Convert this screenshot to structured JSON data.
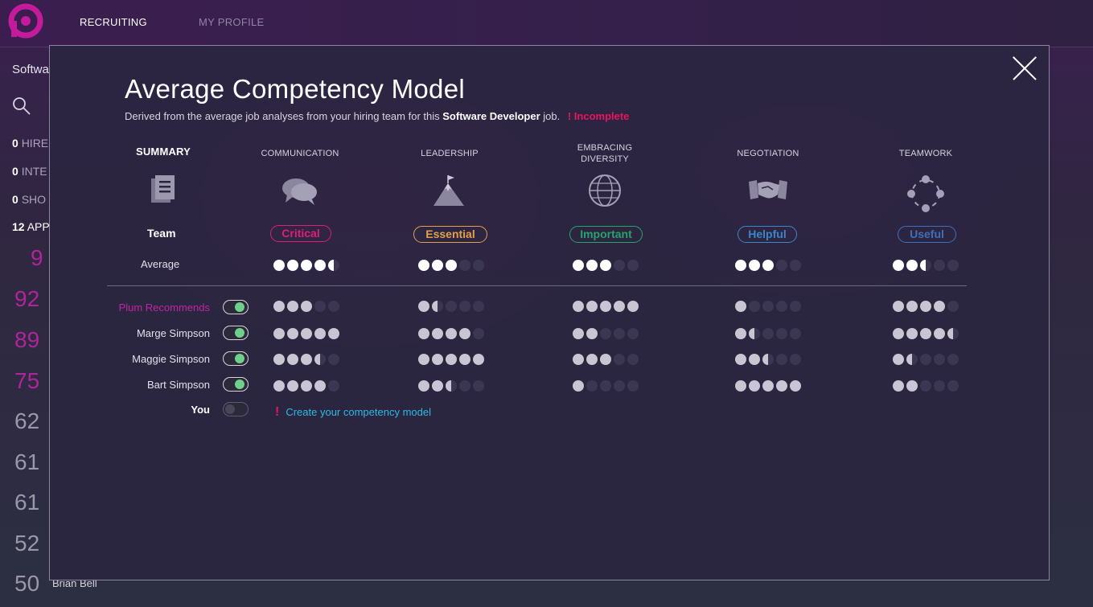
{
  "nav": {
    "items": [
      "RECRUITING",
      "MY PROFILE"
    ]
  },
  "sidebar": {
    "title": "Softwa",
    "stats": [
      {
        "count": "0",
        "label": "HIRE"
      },
      {
        "count": "0",
        "label": "INTE"
      },
      {
        "count": "0",
        "label": "SHO"
      },
      {
        "count": "12",
        "label": "APP"
      }
    ],
    "scores": [
      "9",
      "92",
      "89",
      "75",
      "62",
      "61",
      "61",
      "52",
      "50"
    ],
    "candidate_name": "Brian Bell"
  },
  "modal": {
    "title": "Average Competency Model",
    "subtitle_prefix": "Derived from the average job analyses from your hiring team for this",
    "job": "Software Developer",
    "subtitle_suffix": "job.",
    "warning": "! Incomplete",
    "summary": {
      "heading": "SUMMARY",
      "team": "Team",
      "average": "Average"
    },
    "competencies": [
      {
        "heading": "COMMUNICATION",
        "level": "Critical",
        "color": "#e11d74",
        "average": 4.5
      },
      {
        "heading": "LEADERSHIP",
        "level": "Essential",
        "color": "#e3a04a",
        "average": 3
      },
      {
        "heading": "EMBRACING DIVERSITY",
        "level": "Important",
        "color": "#27a36b",
        "average": 3
      },
      {
        "heading": "NEGOTIATION",
        "level": "Helpful",
        "color": "#3a86c8",
        "average": 3
      },
      {
        "heading": "TEAMWORK",
        "level": "Useful",
        "color": "#3f6fb8",
        "average": 2.5
      }
    ],
    "rows": [
      {
        "name": "Plum Recommends",
        "toggle": "on",
        "ratings": [
          3,
          1.5,
          5,
          1,
          4
        ]
      },
      {
        "name": "Marge Simpson",
        "toggle": "on",
        "ratings": [
          5,
          4,
          2,
          1.5,
          4.5
        ]
      },
      {
        "name": "Maggie Simpson",
        "toggle": "on",
        "ratings": [
          3.5,
          5,
          3,
          2.5,
          1.5
        ]
      },
      {
        "name": "Bart Simpson",
        "toggle": "on",
        "ratings": [
          4,
          2.5,
          1,
          5,
          2
        ]
      },
      {
        "name": "You",
        "toggle": "off",
        "ratings": []
      }
    ],
    "create_link": "Create your competency model",
    "create_mark": "!"
  }
}
